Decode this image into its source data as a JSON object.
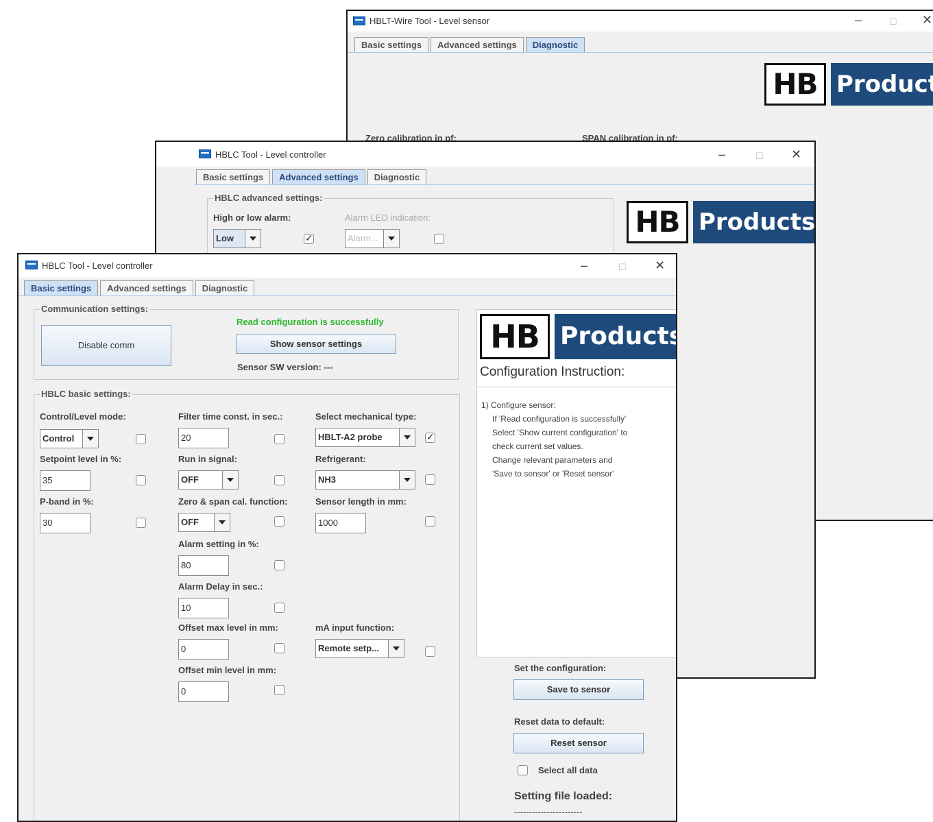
{
  "back_window": {
    "title": "HBLT-Wire Tool - Level sensor",
    "tabs": [
      "Basic settings",
      "Advanced settings",
      "Diagnostic"
    ],
    "active_tab": 2,
    "zero_cal_label": "Zero calibration in pf:",
    "span_cal_label": "SPAN calibration in pf:"
  },
  "mid_window": {
    "title": "HBLC Tool - Level controller",
    "tabs": [
      "Basic settings",
      "Advanced settings",
      "Diagnostic"
    ],
    "active_tab": 1,
    "advanced_legend": "HBLC advanced settings:",
    "high_low_label": "High or low alarm:",
    "high_low_value": "Low",
    "alarm_led_label": "Alarm LED indication:",
    "alarm_led_value": "Alarm..."
  },
  "logo": {
    "hb": "HB",
    "products": "Products"
  },
  "window_controls": {
    "minimize": "–",
    "maximize": "☐",
    "close": "✕"
  },
  "front_window": {
    "title": "HBLC Tool - Level controller",
    "tabs": [
      "Basic settings",
      "Advanced settings",
      "Diagnostic"
    ],
    "active_tab": 0,
    "comm": {
      "legend": "Communication settings:",
      "disable_button": "Disable comm",
      "status": "Read configuration is successfully",
      "show_button": "Show sensor settings",
      "sw_version": "Sensor SW version: ---"
    },
    "basic": {
      "legend": "HBLC basic settings:",
      "control_mode_label": "Control/Level mode:",
      "control_mode_value": "Control",
      "setpoint_label": "Setpoint level in %:",
      "setpoint_value": "35",
      "pband_label": "P-band in %:",
      "pband_value": "30",
      "filter_label": "Filter time const. in sec.:",
      "filter_value": "20",
      "runin_label": "Run in signal:",
      "runin_value": "OFF",
      "zerospan_label": "Zero & span cal. function:",
      "zerospan_value": "OFF",
      "alarm_label": "Alarm setting in %:",
      "alarm_value": "80",
      "alarm_delay_label": "Alarm Delay in sec.:",
      "alarm_delay_value": "10",
      "offset_max_label": "Offset max level in mm:",
      "offset_max_value": "0",
      "offset_min_label": "Offset min level in mm:",
      "offset_min_value": "0",
      "mech_type_label": "Select mechanical type:",
      "mech_type_value": "HBLT-A2 probe",
      "refrigerant_label": "Refrigerant:",
      "refrigerant_value": "NH3",
      "sensor_length_label": "Sensor length in mm:",
      "sensor_length_value": "1000",
      "ma_input_label": "mA input function:",
      "ma_input_value": "Remote setp..."
    },
    "instructions": {
      "title": "Configuration Instruction:",
      "lines": [
        "1) Configure sensor:",
        "   If 'Read configuration is successfully'",
        "   Select 'Show current configuration' to",
        "   check current set values.",
        "   Change relevant parameters and",
        "   'Save to sensor' or 'Reset sensor'"
      ]
    },
    "actions": {
      "set_label": "Set the configuration:",
      "save_button": "Save to sensor",
      "reset_label": "Reset data to default:",
      "reset_button": "Reset sensor",
      "select_all_label": "Select all data",
      "file_loaded_label": "Setting file loaded:",
      "file_loaded_value": "-----------------------"
    }
  },
  "colors": {
    "status_green": "#2db82d",
    "brand_blue": "#1e4a7c",
    "tab_active": "#cfe2f5"
  }
}
